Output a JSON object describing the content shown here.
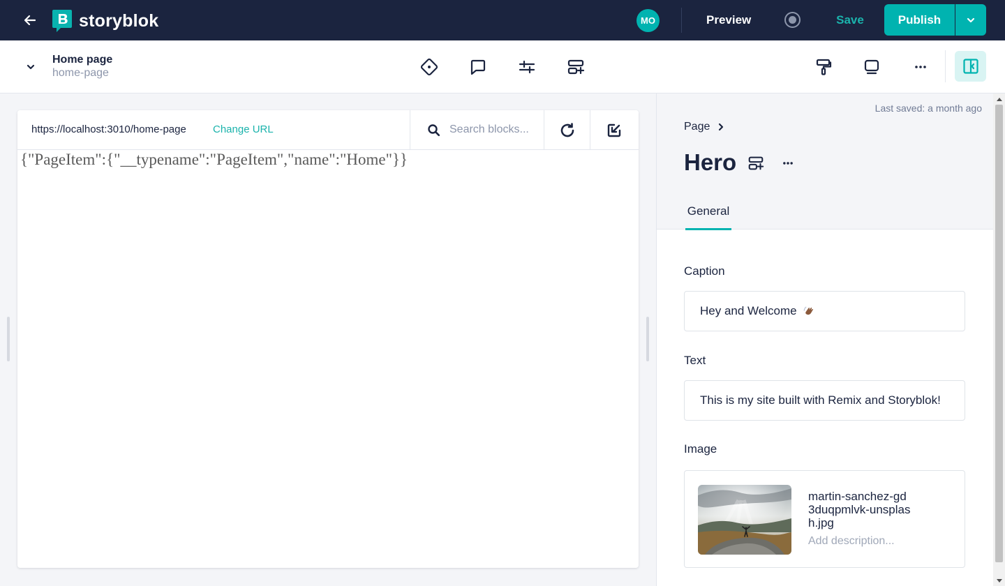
{
  "topbar": {
    "brand": "storyblok",
    "avatar_initials": "MO",
    "preview_label": "Preview",
    "save_label": "Save",
    "publish_label": "Publish",
    "accent_color": "#00b3b0",
    "bg_color": "#1b243f"
  },
  "story": {
    "title": "Home page",
    "slug": "home-page"
  },
  "toolbar_icons": [
    "component-icon",
    "comment-icon",
    "settings-icon",
    "add-block-icon",
    "paint-roller-icon",
    "device-icon",
    "more-icon",
    "sidebar-toggle-icon"
  ],
  "preview": {
    "url": "https://localhost:3010/home-page",
    "change_url_label": "Change URL",
    "search_placeholder": "Search blocks...",
    "json_output": "{\"PageItem\":{\"__typename\":\"PageItem\",\"name\":\"Home\"}}"
  },
  "panel": {
    "last_saved": "Last saved: a month ago",
    "breadcrumb": "Page",
    "block_title": "Hero",
    "tab_label": "General",
    "fields": {
      "caption_label": "Caption",
      "caption_value": "Hey and Welcome",
      "text_label": "Text",
      "text_value": "This is my site built with Remix and Storyblok!",
      "image_label": "Image",
      "image_filename": "martin-sanchez-gd3duqpmlvk-unsplash.jpg",
      "image_description_placeholder": "Add description..."
    }
  }
}
